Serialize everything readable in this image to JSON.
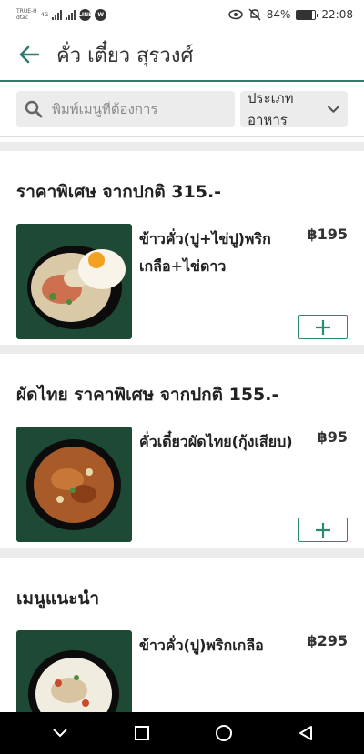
{
  "status_bar": {
    "carrier_1": "TRUE-H",
    "carrier_2": "dtac",
    "network": "4G",
    "circle_icon_1": "LINE",
    "circle_icon_2": "W",
    "battery": "84%",
    "battery_level": 0.84,
    "time": "22:08"
  },
  "header": {
    "title": "คั่ว เตี๋ยว สุรวงศ์"
  },
  "search": {
    "placeholder": "พิมพ์เมนูที่ต้องการ"
  },
  "category_filter": {
    "label": "ประเภทอาหาร"
  },
  "sections": [
    {
      "title": "ราคาพิเศษ จากปกติ 315.-",
      "item": {
        "name": "ข้าวคั่ว(ปู+ไข่ปู)พริกเกลือ+ไข่ดาว",
        "price": "฿195"
      }
    },
    {
      "title": "ผัดไทย ราคาพิเศษ จากปกติ 155.-",
      "item": {
        "name": "คั่วเตี๋ยวผัดไทย(กุ้งเสียบ)",
        "price": "฿95"
      }
    },
    {
      "title": "เมนูแนะนำ",
      "item": {
        "name": "ข้าวคั่ว(ปู)พริกเกลือ",
        "price": "฿295"
      }
    }
  ],
  "colors": {
    "accent": "#2a8a6f",
    "image_bg": "#1e4a35",
    "divider": "#ececec"
  }
}
